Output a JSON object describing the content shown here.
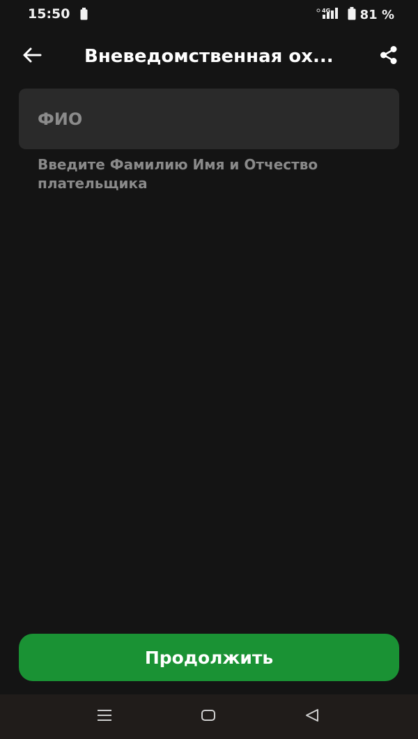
{
  "status_bar": {
    "time": "15:50",
    "network_label": "4G",
    "battery_percent": "81 %"
  },
  "app_bar": {
    "title": "Вневедомственная ох..."
  },
  "form": {
    "fio_placeholder": "ФИО",
    "fio_value": "",
    "fio_hint": "Введите Фамилию Имя и Отчество плательщика"
  },
  "actions": {
    "continue_label": "Продолжить"
  },
  "colors": {
    "background": "#141414",
    "field_background": "#2a2a2a",
    "accent_green": "#1a9234",
    "hint_gray": "#8a8a8a"
  },
  "icons": {
    "back": "arrow-left-icon",
    "share": "share-icon",
    "nav_menu": "menu-lines-icon",
    "nav_home": "home-square-icon",
    "nav_back": "triangle-back-icon"
  }
}
